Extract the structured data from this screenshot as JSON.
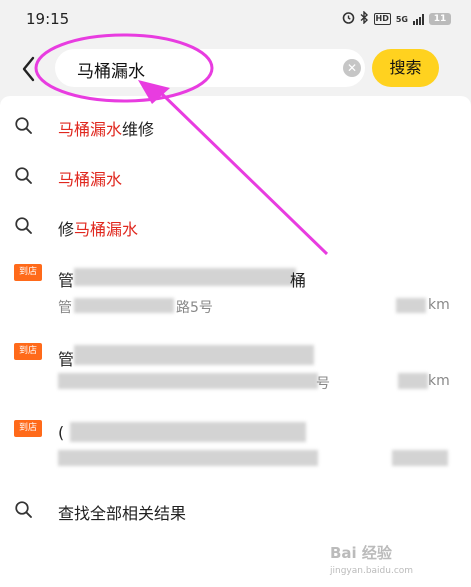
{
  "status_bar": {
    "time": "19:15",
    "net_label": "5G",
    "hd_label": "HD",
    "battery": "11"
  },
  "search": {
    "query": "马桶漏水",
    "clear_icon": "clear-circle-icon",
    "button_label": "搜索",
    "button_color": "#ffd21f"
  },
  "suggestions": [
    {
      "highlight": "马桶漏水",
      "suffix": "维修",
      "prefix": ""
    },
    {
      "highlight": "马桶漏水",
      "suffix": "",
      "prefix": ""
    },
    {
      "highlight": "马桶漏水",
      "suffix": "",
      "prefix": "修"
    }
  ],
  "stores": [
    {
      "tag": "到店",
      "name_first": "管",
      "name_last": "桶",
      "addr_first": "管",
      "addr_mid": "路5号",
      "distance_end": "km"
    },
    {
      "tag": "到店",
      "name_first": "管",
      "addr_end": "号",
      "distance_end": "km"
    },
    {
      "tag": "到店",
      "name_first": "(",
      "distance_end": ""
    }
  ],
  "find_all": "查找全部相关结果",
  "watermark": {
    "main": "Bai 经验",
    "sub": "jingyan.baidu.com"
  },
  "colors": {
    "highlight": "#e0281f",
    "tag": "#ff6a1a",
    "annotation": "#e83ce0"
  }
}
